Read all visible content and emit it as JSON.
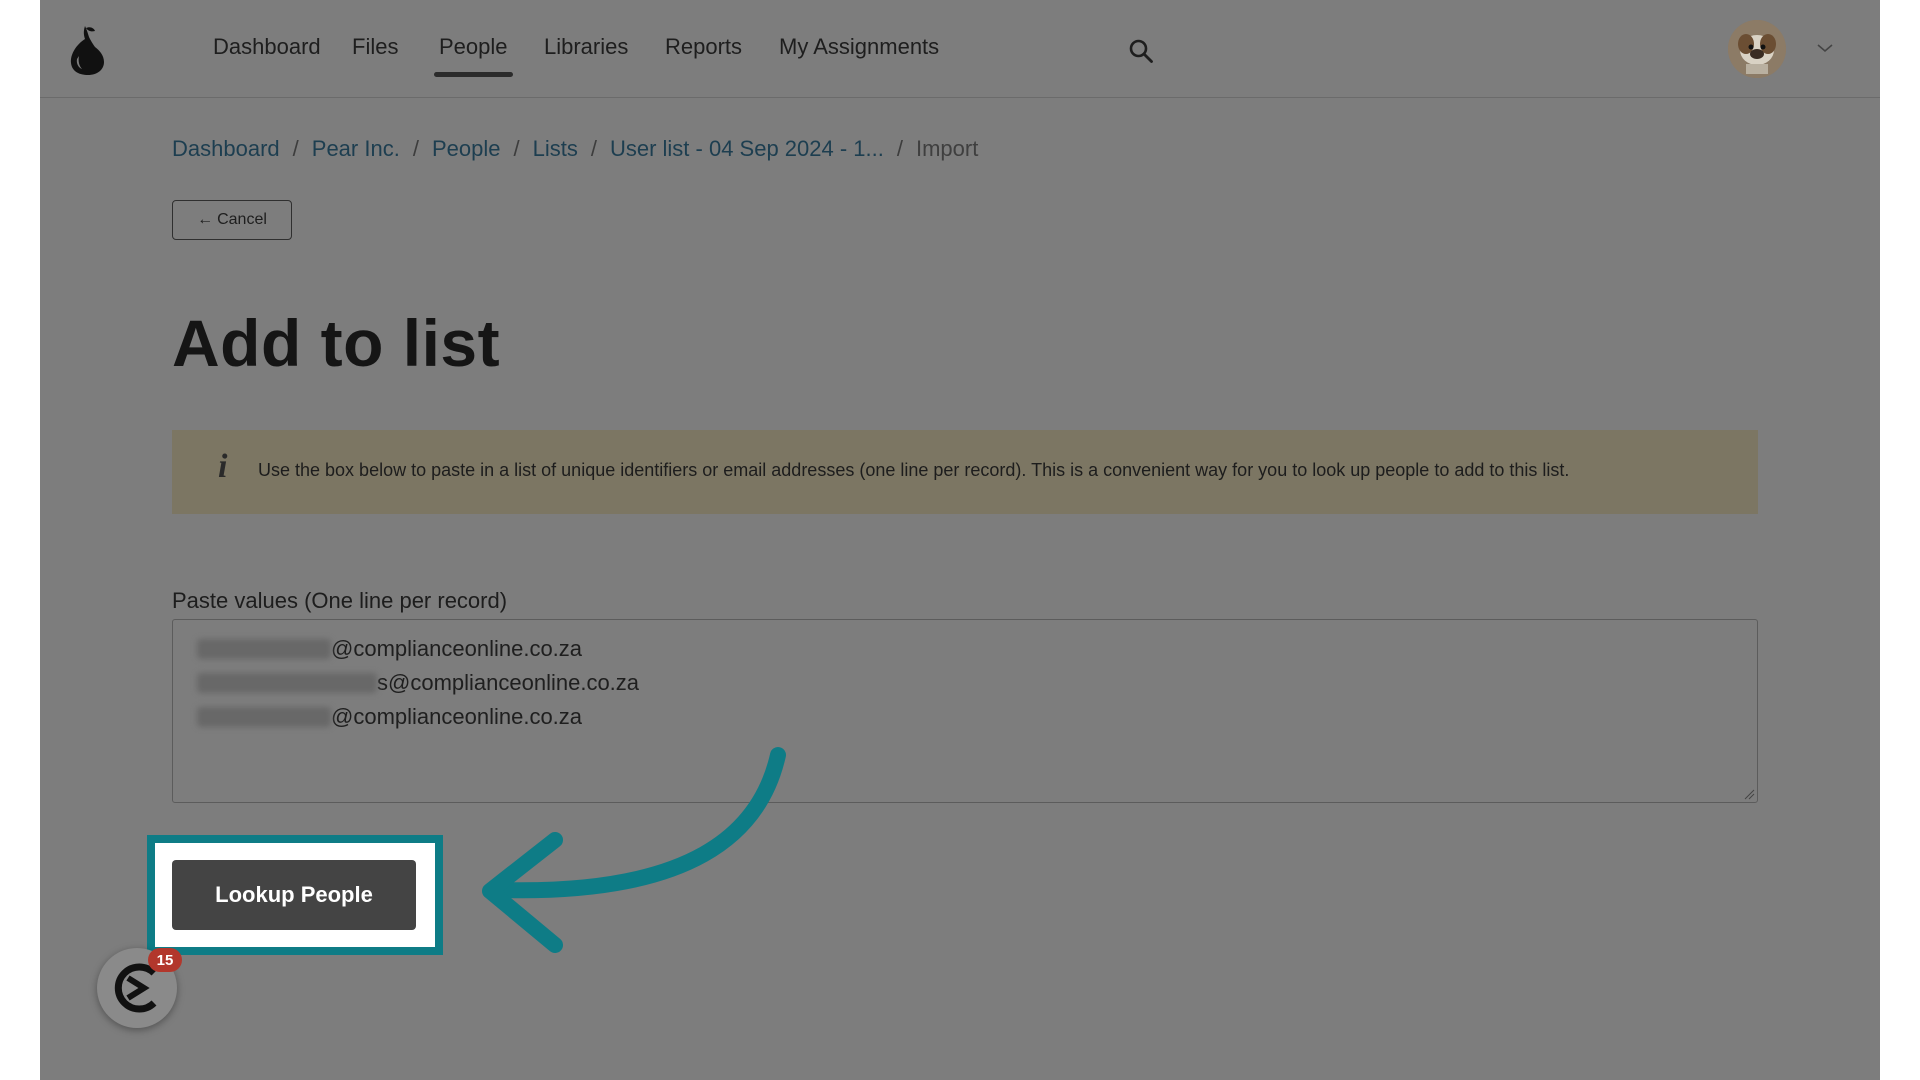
{
  "nav": {
    "items": [
      {
        "label": "Dashboard"
      },
      {
        "label": "Files"
      },
      {
        "label": "People",
        "active": true
      },
      {
        "label": "Libraries"
      },
      {
        "label": "Reports"
      },
      {
        "label": "My Assignments"
      }
    ]
  },
  "breadcrumb": {
    "items": [
      "Dashboard",
      "Pear Inc.",
      "People",
      "Lists",
      "User list - 04 Sep 2024 - 1..."
    ],
    "current": "Import",
    "separator": "/"
  },
  "cancel": {
    "arrow": "←",
    "label": "Cancel"
  },
  "page": {
    "title": "Add to list"
  },
  "info": {
    "icon": "i",
    "text": "Use the box below to paste in a list of unique identifiers or email addresses (one line per record). This is a convenient way for you to look up people to add to this list."
  },
  "paste": {
    "label": "Paste values (One line per record)",
    "lines": [
      "@complianceonline.co.za",
      "s@complianceonline.co.za",
      "@complianceonline.co.za"
    ]
  },
  "lookup": {
    "label": "Lookup People"
  },
  "launcher": {
    "badge": "15"
  },
  "colors": {
    "highlight": "#0e7c86",
    "badge": "#b2372c",
    "info_bg": "#7c7663"
  }
}
